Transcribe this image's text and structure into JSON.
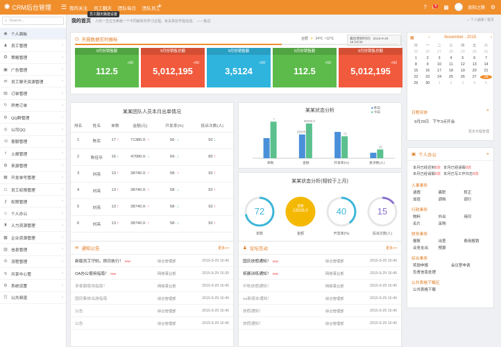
{
  "app": {
    "logo_mark": "❋",
    "title": "CRM后台管理"
  },
  "topnav": {
    "items": [
      "我的关注",
      "员工翻天",
      "团队每日",
      "团队员工"
    ],
    "tooltip": "员工翻天路建设置",
    "plus": "+"
  },
  "topright": {
    "mail_badge": "8",
    "user": "欧阳之腾"
  },
  "search": {
    "placeholder": "Search..."
  },
  "sidebar": {
    "items": [
      {
        "icon": "◉",
        "label": "个人面板"
      },
      {
        "icon": "♟",
        "label": "员工管理"
      },
      {
        "icon": "✪",
        "label": "策略管理"
      },
      {
        "icon": "▣",
        "label": "广告管理"
      },
      {
        "icon": "✉",
        "label": "员工聊天资源管理"
      },
      {
        "icon": "▤",
        "label": "订单管理"
      },
      {
        "icon": "↻",
        "label": "异常订单"
      },
      {
        "icon": "⚙",
        "label": "QQ群管理"
      },
      {
        "icon": "◎",
        "label": "公司QQ"
      },
      {
        "icon": "☏",
        "label": "客服管理"
      },
      {
        "icon": "⇡",
        "label": "上报管理"
      },
      {
        "icon": "✿",
        "label": "来源管理"
      },
      {
        "icon": "▦",
        "label": "开发单号管理"
      },
      {
        "icon": "☖",
        "label": "员工权限管理"
      },
      {
        "icon": "⚷",
        "label": "权限管理"
      },
      {
        "icon": "☺",
        "label": "个人办公"
      },
      {
        "icon": "♜",
        "label": "人力资源管理"
      },
      {
        "icon": "▩",
        "label": "企业资源管理"
      },
      {
        "icon": "▥",
        "label": "信息管理"
      },
      {
        "icon": "✇",
        "label": "流程管理"
      },
      {
        "icon": "↯",
        "label": "共享中心管"
      },
      {
        "icon": "⚙",
        "label": "系统设置"
      },
      {
        "icon": "☷",
        "label": "公共频道"
      }
    ]
  },
  "breadcrumb": {
    "title": "我的首页",
    "subtitle": "人的一生应当奉献一个不同解析的学习过程。有关事些学程完成。 ——鲁迅",
    "right": "⌂ 个人面板 / 首页"
  },
  "realtime": {
    "title": "天猫数据实时报标",
    "weather_label": "合肥",
    "weather": "24℃ ~12℃",
    "update": "最后更新时间：2015-9-29 15:19:30",
    "kpis": [
      {
        "title": "9月份销售额",
        "plus": "+50",
        "value": "112.5",
        "color": "#5dbb4b"
      },
      {
        "title": "9月份销售总额",
        "plus": "+50",
        "value": "5,012,195",
        "color": "#f15a3c"
      },
      {
        "title": "9月份销售额",
        "plus": "+50",
        "value": "3,5124",
        "color": "#2fb4de"
      },
      {
        "title": "9月份销售额",
        "plus": "+50",
        "value": "112.5",
        "color": "#5dbb4b"
      },
      {
        "title": "9月份销售总额",
        "plus": "+50",
        "value": "5,012,195",
        "color": "#f15a3c"
      }
    ]
  },
  "attendance": {
    "title": "某某团队人员本月出单情况",
    "headers": [
      "排名",
      "姓名",
      "单数",
      "金额(元)",
      "开发率(%)",
      "投诉次数(人)"
    ],
    "rows": [
      [
        "1",
        "陈实",
        "17",
        "71380.0",
        "56",
        "92"
      ],
      [
        "2",
        "陈佳乐",
        "16",
        "47680.0",
        "69",
        "85"
      ],
      [
        "3",
        "刘亮",
        "13",
        "38740.0",
        "58",
        "92"
      ],
      [
        "4",
        "刘亮",
        "13",
        "38740.0",
        "58",
        "92"
      ],
      [
        "5",
        "刘亮",
        "13",
        "38740.0",
        "58",
        "92"
      ],
      [
        "6",
        "刘亮",
        "13",
        "38740.0",
        "58",
        "92"
      ]
    ],
    "row_arrows": [
      [
        "up",
        "up",
        "dn",
        "dn"
      ],
      [
        "dn",
        "dn",
        "dn",
        "up"
      ],
      [
        "up",
        "up",
        "up",
        "up"
      ],
      [
        "up",
        "up",
        "dn",
        "up"
      ],
      [
        "up",
        "up",
        "dn",
        "up"
      ],
      [
        "up",
        "up",
        "dn",
        "up"
      ]
    ],
    "dashes": [
      "-",
      "-",
      "-",
      "-",
      "-",
      "-"
    ]
  },
  "chart_data": [
    {
      "type": "bar",
      "title": "某某状态分析",
      "categories": [
        "单数",
        "金额",
        "开发率(%)",
        "投诉数(人)"
      ],
      "series": [
        {
          "name": "昨日",
          "values": [
            55,
            65,
            72,
            15
          ],
          "color": "#4a90d9"
        },
        {
          "name": "今日",
          "values": [
            100,
            95,
            60,
            24
          ],
          "color": "#5ac18e"
        }
      ],
      "data_labels": [
        "7",
        "35000.0",
        "72",
        "25"
      ],
      "data_labels_2": [
        "",
        "25000.0",
        "",
        ""
      ],
      "ylim": [
        0,
        110
      ]
    }
  ],
  "status2": {
    "title": "某某状态分析(相较于上月)",
    "gauges": [
      {
        "value": "72",
        "label": "单数",
        "sub": "",
        "color": "#3bb6d8",
        "fill": 0.72,
        "solid": false
      },
      {
        "value": "23026.0",
        "label": "金额",
        "sub": "金额",
        "color": "#f5b800",
        "fill": 1,
        "solid": true
      },
      {
        "value": "40",
        "label": "开发率(%)",
        "sub": "",
        "color": "#3bb6d8",
        "fill": 0.4,
        "solid": false
      },
      {
        "value": "15",
        "label": "投诉次数(人)",
        "sub": "",
        "color": "#8a6fce",
        "fill": 0.15,
        "solid": false
      }
    ]
  },
  "notice": {
    "title": "通知公告",
    "more": "更多>>",
    "rows": [
      {
        "t": "新版员工守则，即日执行！",
        "new": "new",
        "d": "综合管理部",
        "tm": "2015-9-29 16:40",
        "gray": false
      },
      {
        "t": "OA办公使用指南！",
        "new": "new",
        "d": "网络事业部",
        "tm": "2015-9-29 15:30",
        "gray": false
      },
      {
        "t": "多客服使用指南！",
        "new": "",
        "d": "网络事业部",
        "tm": "2015-9-29 16:40",
        "gray": true
      },
      {
        "t": "国庆集体出游指南",
        "new": "",
        "d": "综合管理部",
        "tm": "2015-9-29 16:40",
        "gray": true
      },
      {
        "t": "公告",
        "new": "",
        "d": "综合管理部",
        "tm": "2015-9-29 16:40",
        "gray": true
      },
      {
        "t": "公告",
        "new": "",
        "d": "综合管理部",
        "tm": "2015-9-29 16:40",
        "gray": true
      }
    ]
  },
  "forum": {
    "title": "论坛互动",
    "more": "更多>>",
    "rows": [
      {
        "t": "国庆放假通知！",
        "new": "new",
        "d": "综合管理部",
        "tm": "2015-9-29 16:40",
        "gray": false
      },
      {
        "t": "拓展训练通知！",
        "new": "new",
        "d": "网络事业部",
        "tm": "2015-9-29 16:40",
        "gray": false
      },
      {
        "t": "中秋放假通知！",
        "new": "",
        "d": "网络事业部",
        "tm": "2015-9-29 16:40",
        "gray": true
      },
      {
        "t": "oa新版本通知！",
        "new": "",
        "d": "综合管理部",
        "tm": "2015-9-29 16:40",
        "gray": true
      },
      {
        "t": "放假通知！",
        "new": "",
        "d": "综合管理部",
        "tm": "2015-9-29 16:40",
        "gray": true
      },
      {
        "t": "放假通知！",
        "new": "",
        "d": "综合管理部",
        "tm": "2015-9-29 16:40",
        "gray": true
      }
    ]
  },
  "calendar": {
    "month": "November , 2015",
    "weekdays": [
      "日",
      "一",
      "二",
      "三",
      "四",
      "五",
      "六"
    ],
    "days": [
      "25",
      "26",
      "27",
      "28",
      "29",
      "30",
      "31",
      "1",
      "2",
      "3",
      "4",
      "5",
      "6",
      "7",
      "8",
      "9",
      "10",
      "11",
      "12",
      "13",
      "14",
      "15",
      "16",
      "17",
      "18",
      "19",
      "20",
      "21",
      "22",
      "23",
      "24",
      "25",
      "26",
      "27",
      "28",
      "29",
      "30",
      "1",
      "2",
      "3",
      "4",
      "5"
    ],
    "today_index": 34,
    "schedule_title": "日程安排",
    "schedule_date": "9月29日",
    "schedule_item": "下午3点开会",
    "schedule_more": "更多日程管理"
  },
  "office": {
    "title": "个人办公",
    "stats": [
      [
        "本月已经迟到",
        "0次",
        "本月已经请假",
        "0次"
      ],
      [
        "本月已经请假",
        "0次",
        "本月已写工作日志",
        "0次"
      ]
    ],
    "hr_title": "人事事务",
    "hr_items": [
      "请假",
      "离职",
      "转正",
      "加班",
      "调档",
      "调行"
    ],
    "admin_title": "行政事务",
    "admin_items": [
      "物料",
      "外出",
      "用印",
      "名片",
      "采购"
    ],
    "fin_title": "财务事务",
    "fin_items": [
      "报账",
      "出差",
      "费用报销",
      "业务支出",
      "预算"
    ],
    "comp_title": "综合事务",
    "comp_items": [
      "奖励申报",
      "会议室申请",
      "负责信息处理"
    ],
    "form_title": "公共表格下载区",
    "form_item": "公共表格下载"
  }
}
